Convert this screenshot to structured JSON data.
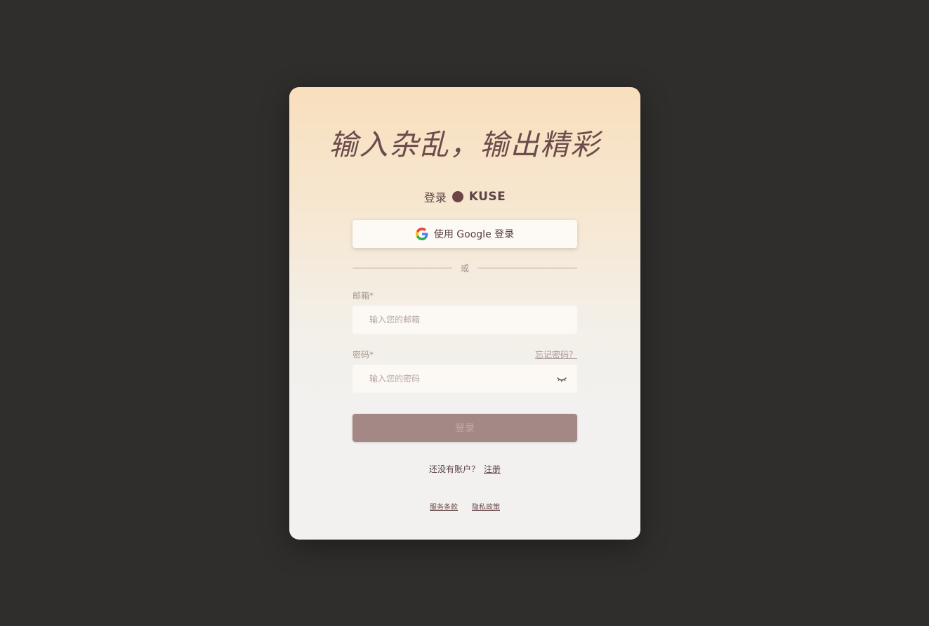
{
  "headline": "输入杂乱，输出精彩",
  "brand": {
    "login_text": "登录",
    "name": "KUSE",
    "logo_icon": "dot-logo-icon",
    "color": "#6b4545"
  },
  "google_button": {
    "label": "使用 Google 登录",
    "icon": "google-icon"
  },
  "divider_text": "或",
  "email": {
    "label": "邮箱*",
    "placeholder": "输入您的邮箱",
    "value": ""
  },
  "password": {
    "label": "密码*",
    "forgot_label": "忘记密码？",
    "placeholder": "输入您的密码",
    "value": "",
    "toggle_icon": "eye-closed-icon"
  },
  "login_button": {
    "label": "登录",
    "color": "#a48886"
  },
  "signup": {
    "prompt": "还没有账户？",
    "link": "注册"
  },
  "footer": {
    "terms": "服务条款",
    "privacy": "隐私政策"
  },
  "colors": {
    "background": "#302e2c",
    "card_top": "#f8dfbd",
    "card_bottom": "#f2f1ef",
    "text_primary": "#5a4242"
  }
}
